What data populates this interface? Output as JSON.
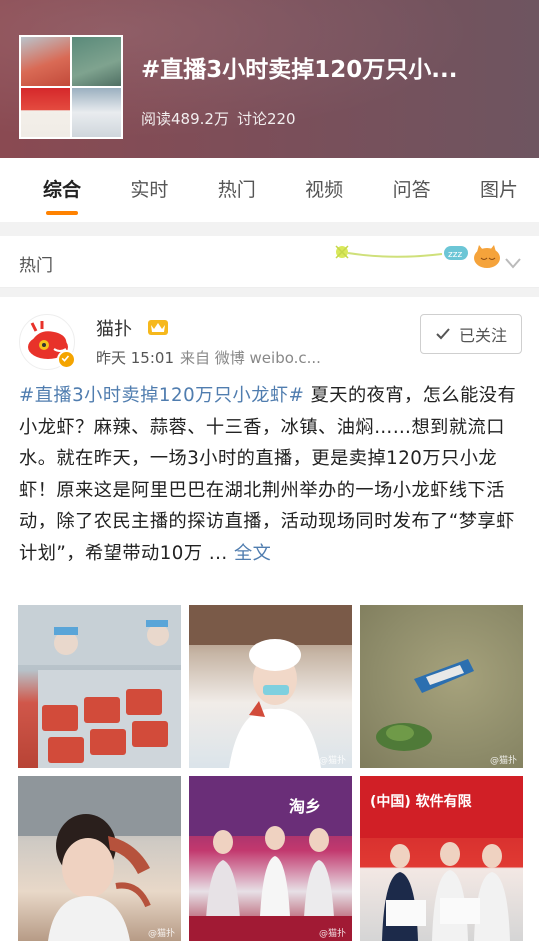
{
  "topic": {
    "title": "#直播3小时卖掉120万只小...",
    "reads": "阅读489.2万",
    "discussions": "讨论220"
  },
  "tabs": [
    "综合",
    "实时",
    "热门",
    "视频",
    "问答",
    "图片"
  ],
  "active_tab": "综合",
  "hot_section": {
    "label": "热门"
  },
  "post": {
    "username": "猫扑",
    "time": "昨天 15:01",
    "source": "来自 微博 weibo.c...",
    "follow_label": "已关注",
    "hashtag": "#直播3小时卖掉120万只小龙虾#",
    "body": " 夏天的夜宵，怎么能没有小龙虾？麻辣、蒜蓉、十三香，冰镇、油焖……想到就流口水。就在昨天，一场3小时的直播，更是卖掉120万只小龙虾！原来这是阿里巴巴在湖北荆州举办的一场小龙虾线下活动，除了农民主播的探访直播，活动现场同时发布了“梦享虾计划”，希望带动10万 ... ",
    "more": "全文",
    "watermark": "@猫扑",
    "photo_texts": {
      "p5": "淘乡",
      "p6": "(中国) 软件有限"
    }
  },
  "colors": {
    "accent": "#ff8200",
    "link": "#507daf",
    "header_bg": "#84505a"
  }
}
